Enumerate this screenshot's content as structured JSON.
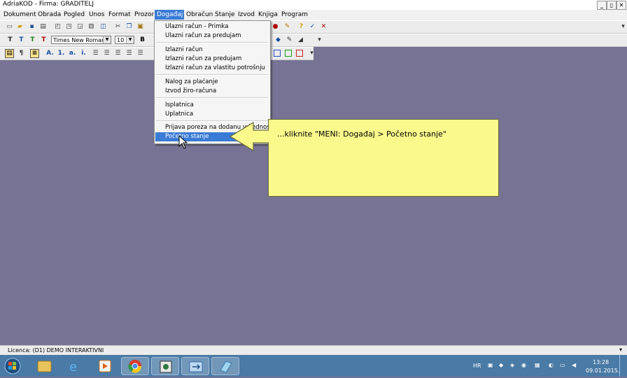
{
  "window": {
    "title": "AdriaKOD - Firma: GRADITELJ",
    "minimize": "_",
    "restore": "▯",
    "close": "✕"
  },
  "menubar": {
    "items": [
      "Dokument",
      "Obrada",
      "Pogled",
      "Unos",
      "Format",
      "Prozor",
      "Događaj",
      "Obračun",
      "Stanje",
      "Izvod",
      "Knjiga",
      "Program"
    ]
  },
  "format_toolbar": {
    "font_name": "Times New Roman",
    "font_size": "10",
    "bold_label": "B"
  },
  "dropdown": {
    "items": [
      "Ulazni račun - Primka",
      "Ulazni račun za predujam",
      "Izlazni račun",
      "Izlazni račun za predujam",
      "Izlazni račun za vlastitu potrošnju",
      "Nalog za plaćanje",
      "Izvod žiro-računa",
      "Isplatnica",
      "Uplatnica",
      "Prijava poreza na dodanu vrijednost",
      "Početno stanje"
    ],
    "highlighted": "Početno stanje"
  },
  "callout": {
    "text": "...kliknite \"MENI: Događaj > Početno stanje\"",
    "color": "#fafa8c"
  },
  "statusbar": {
    "licence": "Licenca:  (D1) DEMO INTERAKTIVNI"
  },
  "taskbar": {
    "language": "HR",
    "time": "13:28",
    "date": "09.01.2015."
  },
  "colors": {
    "desktop": "#777394",
    "accent": "#3a7bd5",
    "taskbar": "#4a7aa6"
  }
}
